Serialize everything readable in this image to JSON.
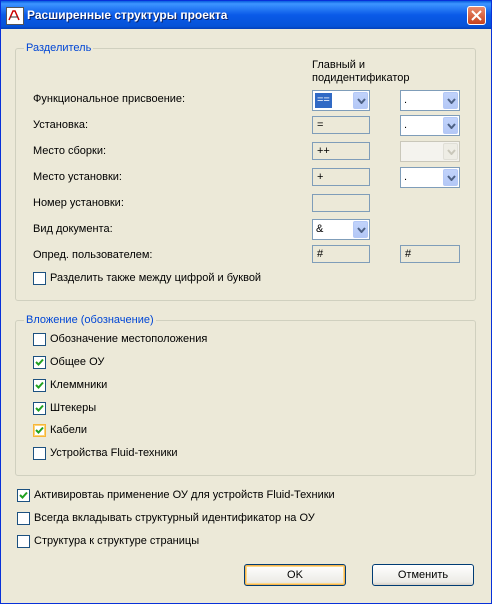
{
  "window": {
    "title": "Расширенные структуры проекта",
    "close_glyph": "×"
  },
  "separator": {
    "legend": "Разделитель",
    "col_header_line1": "Главный и",
    "col_header_line2": "подидентификатор",
    "rows": [
      {
        "label": "Функциональное присвоение:",
        "main": "==",
        "sub": "."
      },
      {
        "label": "Установка:",
        "main": "=",
        "sub": "."
      },
      {
        "label": "Место сборки:",
        "main": "++",
        "sub": ""
      },
      {
        "label": "Место установки:",
        "main": "+",
        "sub": "."
      },
      {
        "label": "Номер установки:",
        "main": ""
      },
      {
        "label": "Вид документа:",
        "main": "&"
      },
      {
        "label": "Опред. пользователем:",
        "main": "#",
        "sub": "#"
      }
    ],
    "split_digit_letter": {
      "label": "Разделить также между цифрой и буквой",
      "checked": false
    }
  },
  "nesting": {
    "legend": "Вложение (обозначение)",
    "items": [
      {
        "label": "Обозначение местоположения",
        "checked": false
      },
      {
        "label": "Общее ОУ",
        "checked": true
      },
      {
        "label": "Клеммники",
        "checked": true
      },
      {
        "label": "Штекеры",
        "checked": true
      },
      {
        "label": "Кабели",
        "checked": true
      },
      {
        "label": "Устройства Fluid-техники",
        "checked": false
      }
    ]
  },
  "options": [
    {
      "label": "Активировтаь применение ОУ для устройств Fluid-Техники",
      "checked": true
    },
    {
      "label": "Всегда вкладывать структурный идентификатор на ОУ",
      "checked": false
    },
    {
      "label": "Структура к структуре страницы",
      "checked": false
    }
  ],
  "buttons": {
    "ok": "OK",
    "cancel": "Отменить"
  },
  "colors": {
    "titlebar": "#0a5ae8",
    "legend_text": "#0046d5",
    "dialog_bg": "#ece9d8",
    "selection": "#316ac5"
  },
  "icons": {
    "app": "app-icon",
    "close": "close-icon",
    "dropdown": "chevron-down-icon",
    "check": "checkmark-icon"
  }
}
